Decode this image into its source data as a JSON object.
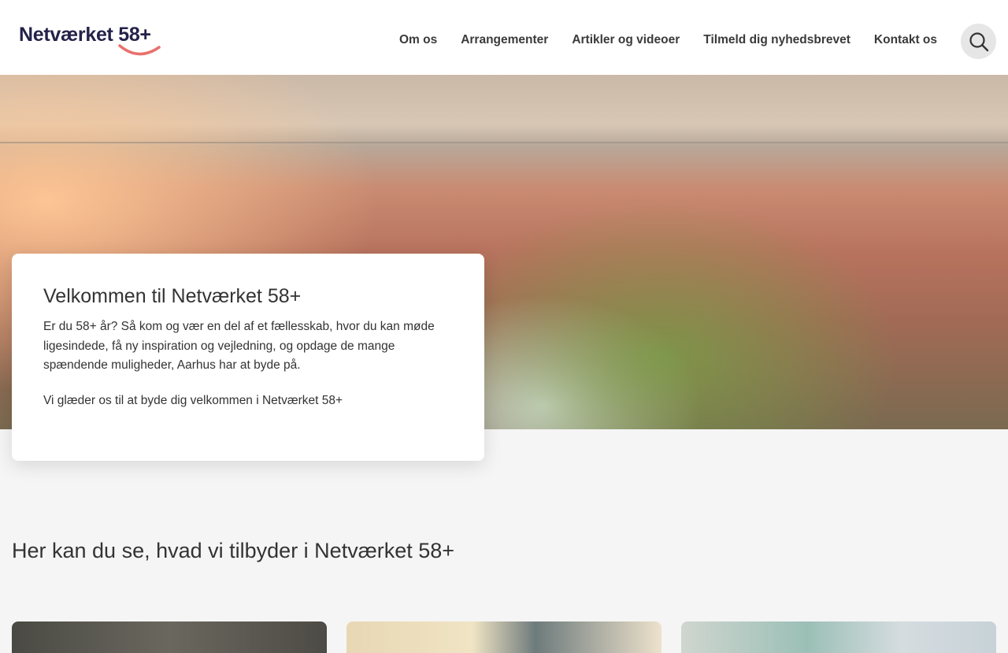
{
  "header": {
    "logo": "Netværket 58+",
    "nav": [
      "Om os",
      "Arrangementer",
      "Artikler og videoer",
      "Tilmeld dig nyhedsbrevet",
      "Kontakt os"
    ]
  },
  "welcome": {
    "title": "Velkommen til Netværket 58+",
    "body": "Er du 58+ år? Så kom og vær en del af et fællesskab, hvor du kan møde ligesindede, få ny inspiration og vejledning, og opdage de mange spændende muligheder, Aarhus har at byde på.",
    "closing": "Vi glæder os til at byde dig velkommen i Netværket 58+"
  },
  "offers": {
    "title": "Her kan du se, hvad vi tilbyder i Netværket 58+"
  }
}
